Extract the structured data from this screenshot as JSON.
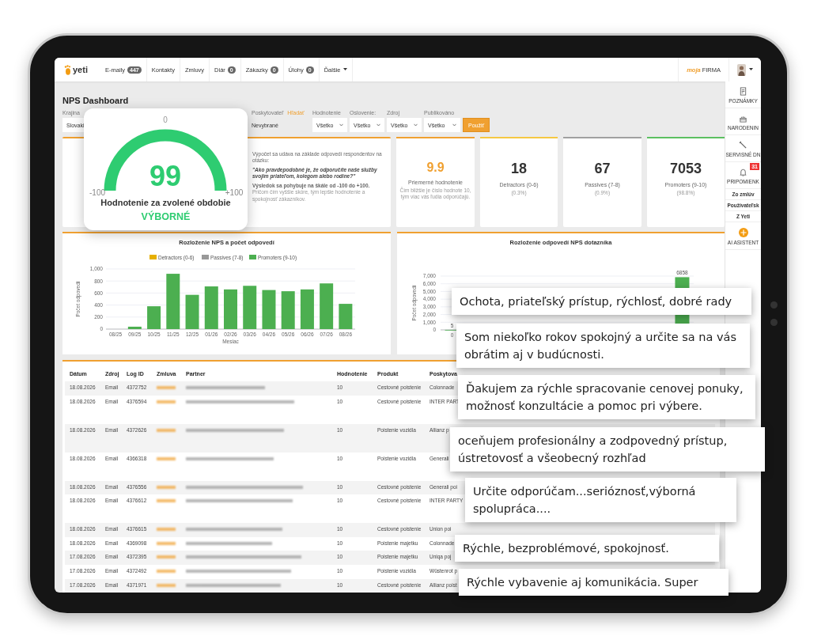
{
  "nav": {
    "logo": "yeti",
    "items": [
      {
        "label": "E-maily",
        "badge": "447",
        "kind": "link"
      },
      {
        "label": "Kontakty",
        "kind": "link"
      },
      {
        "label": "Zmluvy",
        "kind": "link"
      },
      {
        "label": "Diár",
        "badge": "0",
        "kind": "link"
      },
      {
        "label": "Zákazky",
        "badge": "0",
        "kind": "link"
      },
      {
        "label": "Úlohy",
        "badge": "0",
        "kind": "link"
      },
      {
        "label": "Ďalšie",
        "kind": "dropdown"
      }
    ],
    "company_prefix": "moja",
    "company": "FIRMA"
  },
  "title": "NPS Dashboard",
  "filters": [
    {
      "label": "Krajina",
      "value": "Slovaki",
      "kind": "select"
    },
    {
      "label": "Poskytovateľ",
      "link": "Hľadať",
      "value": "Nevybrané",
      "kind": "text"
    },
    {
      "label": "Hodnotenie",
      "value": "Všetko",
      "kind": "select"
    },
    {
      "label": "Oslovenie:",
      "value": "Všetko",
      "kind": "select"
    },
    {
      "label": "Zdroj",
      "value": "Všetko",
      "kind": "select"
    },
    {
      "label": "Publikováno",
      "value": "Všetko",
      "kind": "select"
    }
  ],
  "apply_button": "Použiť",
  "description": [
    "Výpočet sa udáva na základe odpovedí respondentov na otázku:",
    "\"Ako pravdepodobné je, že odporučíte naše služby svojim priateľom, kolegom alebo rodine?\"",
    "**Výsledok sa pohybuje na škále od -100 do +100.** Pričom čím vyššie skóre, tým lepšie hodnotenie a spokojnosť zákazníkov."
  ],
  "stats": [
    {
      "kind": "average",
      "value": "9.9",
      "label": "Priemerné hodnotenie",
      "note": "Čím bližšie je číslo hodnote 10, tým viac vás ľudia odporúčajú.",
      "color": "#f0a030"
    },
    {
      "kind": "count",
      "value": "18",
      "label": "Detractors (0-6)",
      "note": "(0.3%)",
      "color": "#f5c842"
    },
    {
      "kind": "count",
      "value": "67",
      "label": "Passives (7-8)",
      "note": "(0.9%)",
      "color": "#a0a0a0"
    },
    {
      "kind": "count",
      "value": "7053",
      "label": "Promoters (9-10)",
      "note": "(98.8%)",
      "color": "#5cc060"
    }
  ],
  "gauge": {
    "top_label": "0",
    "value": "99",
    "min_label": "-100",
    "max_label": "+100",
    "title": "Hodnotenie za zvolené obdobie",
    "rating": "VÝBORNÉ"
  },
  "charts": [
    {
      "chart_data": {
        "type": "bar",
        "title": "Rozloženie NPS a počet odpovedí",
        "xlabel": "Mesiac",
        "ylabel": "Počet odpovedí",
        "stacked": true,
        "grid": true,
        "legend": "top",
        "categories": [
          "08/25",
          "09/25",
          "10/25",
          "11/25",
          "12/25",
          "01/26",
          "02/26",
          "03/26",
          "04/26",
          "05/26",
          "06/26",
          "07/26",
          "08/26"
        ],
        "ylim": [
          0,
          1000
        ],
        "yticks": [
          0,
          200,
          400,
          600,
          800,
          {
            "value": 1000,
            "label": "1,000"
          }
        ],
        "series": [
          {
            "name": "Detractors (0-6)",
            "color": "#e6b000",
            "values": [
              0,
              0,
              0,
              0,
              0,
              0,
              0,
              0,
              0,
              0,
              0,
              0,
              0
            ]
          },
          {
            "name": "Passives (7-8)",
            "color": "#999999",
            "values": [
              0,
              0,
              0,
              0,
              0,
              0,
              0,
              0,
              0,
              0,
              0,
              0,
              0
            ]
          },
          {
            "name": "Promoters (9-10)",
            "color": "#4caf50",
            "values": [
              0,
              40,
              380,
              920,
              570,
              710,
              660,
              720,
              650,
              630,
              660,
              760,
              420
            ]
          }
        ]
      }
    },
    {
      "chart_data": {
        "type": "bar",
        "title": "Rozloženie odpovedí NPS dotazníka",
        "ylabel": "Počet odpovedí",
        "data_labels": true,
        "grid": true,
        "categories": [
          "0",
          null,
          null,
          null,
          null,
          null,
          null,
          null,
          null,
          null,
          null
        ],
        "values": [
          5,
          null,
          null,
          null,
          null,
          null,
          null,
          null,
          null,
          null,
          6858
        ],
        "ylim": [
          0,
          7000
        ],
        "yticks": [
          0,
          {
            "value": 1000,
            "label": "1,000"
          },
          {
            "value": 2000,
            "label": "2,000"
          },
          {
            "value": 3000,
            "label": "3,000"
          },
          {
            "value": 4000,
            "label": "4,000"
          },
          {
            "value": 5000,
            "label": "5,000"
          },
          {
            "value": 6000,
            "label": "6,000"
          },
          {
            "value": 7000,
            "label": "7,000"
          }
        ]
      }
    }
  ],
  "table": {
    "columns": [
      "Dátum",
      "Zdroj",
      "Log ID",
      "Zmluva",
      "Partner",
      "Hodnotenie",
      "Produkt",
      "Poskytova"
    ],
    "rows": [
      [
        "18.08.2026",
        "Email",
        "4372752",
        "",
        "",
        "10",
        "Cestovné poistenie",
        "Colonnade"
      ],
      [
        "18.08.2026",
        "Email",
        "4376594",
        "",
        "",
        "10",
        "Cestovné poistenie",
        "INTER PART"
      ],
      [
        "18.08.2026",
        "Email",
        "4372626",
        "",
        "",
        "10",
        "Poistenie vozidla",
        "Allianz p"
      ],
      [
        "18.08.2026",
        "Email",
        "4366318",
        "",
        "",
        "10",
        "Poistenie vozidla",
        "Generali"
      ],
      [
        "18.08.2026",
        "Email",
        "4376556",
        "",
        "",
        "10",
        "Cestovné poistenie",
        "Generali poi"
      ],
      [
        "18.08.2026",
        "Email",
        "4376612",
        "",
        "",
        "10",
        "Cestovné poistenie",
        "INTER PARTY"
      ],
      [
        "18.08.2026",
        "Email",
        "4376615",
        "",
        "",
        "10",
        "Cestovné poistenie",
        "Union poi"
      ],
      [
        "18.08.2026",
        "Email",
        "4369098",
        "",
        "",
        "10",
        "Poistenie majetku",
        "Colonnade"
      ],
      [
        "17.08.2026",
        "Email",
        "4372395",
        "",
        "",
        "10",
        "Poistenie majetku",
        "Uniqa poj"
      ],
      [
        "17.08.2026",
        "Email",
        "4372492",
        "",
        "",
        "10",
        "Poistenie vozidla",
        "Wüstenrot p"
      ],
      [
        "17.08.2026",
        "Email",
        "4371971",
        "",
        "",
        "10",
        "Cestovné poistenie",
        "Allianz poist"
      ]
    ]
  },
  "sidebar": [
    {
      "kind": "notes",
      "label": "POZNÁMKY"
    },
    {
      "kind": "cake",
      "label": "NARODENIN"
    },
    {
      "kind": "wrench",
      "label": "SERVISNÉ DN"
    },
    {
      "kind": "bell",
      "label": "PRIPOMIENK",
      "badge": "31"
    },
    {
      "kind": "sub",
      "label": "Zo zmlúv"
    },
    {
      "kind": "sub",
      "label": "Používateľsk"
    },
    {
      "kind": "sub",
      "label": "Z Yeti"
    },
    {
      "kind": "ai",
      "label": "AI ASISTENT"
    }
  ],
  "quotes": [
    "Ochota, priateľský prístup, rýchlosť, dobré rady",
    "Som niekoľko rokov spokojný a určite sa na vás obrátim aj v budúcnosti.",
    "Ďakujem za rýchle spracovanie cenovej ponuky, možnosť konzultácie a pomoc pri výbere.",
    "oceňujem profesionálny a zodpovedný prístup, ústretovosť a všeobecný rozhľad",
    "Určite odporúčam...serióznosť,výborná spolupráca....",
    "Rýchle, bezproblémové, spokojnosť.",
    "Rýchle vybavenie aj komunikácia. Super"
  ]
}
